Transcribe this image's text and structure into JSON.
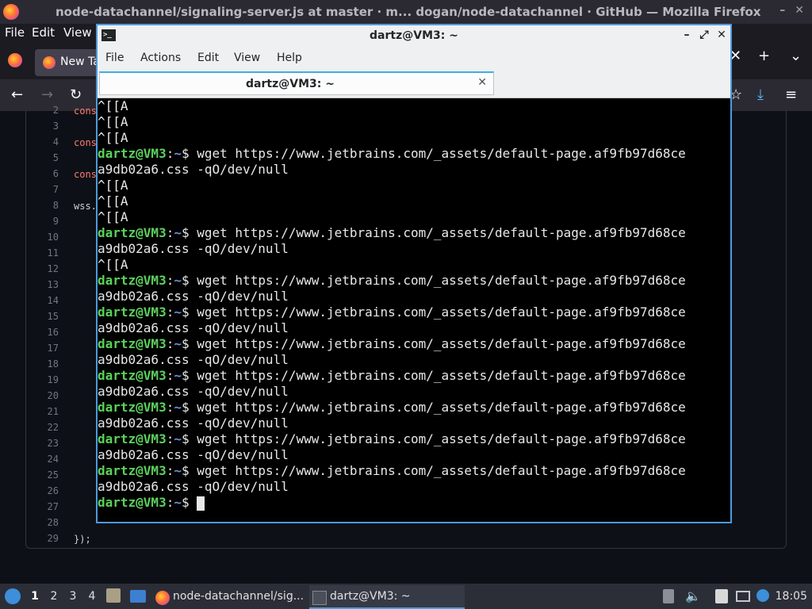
{
  "firefox": {
    "window_title": "node-datachannel/signaling-server.js at master · m...  dogan/node-datachannel · GitHub — Mozilla Firefox",
    "menu": [
      "File",
      "Edit",
      "View"
    ],
    "tab_label": "New Ta",
    "line_numbers": [
      "2",
      "3",
      "4",
      "5",
      "6",
      "7",
      "8",
      "9",
      "10",
      "11",
      "12",
      "13",
      "14",
      "15",
      "16",
      "17",
      "18",
      "19",
      "20",
      "21",
      "22",
      "23",
      "24",
      "25",
      "26",
      "27",
      "28",
      "29"
    ],
    "code_fragments": [
      "cons",
      "cons",
      "cons",
      "wss.",
      "});"
    ]
  },
  "terminal": {
    "window_title": "dartz@VM3: ~",
    "menu": [
      "File",
      "Actions",
      "Edit",
      "View",
      "Help"
    ],
    "tab_label": "dartz@VM3: ~",
    "prompt_user": "dartz@VM3",
    "prompt_sep": ":",
    "prompt_path": "~",
    "prompt_symbol": "$",
    "command": " wget https://www.jetbrains.com/_assets/default-page.af9fb97d68ce",
    "command_wrap": "a9db02a6.css -qO/dev/null",
    "arrow_echo": "^[[A"
  },
  "taskbar": {
    "workspaces": [
      "1",
      "2",
      "3",
      "4"
    ],
    "tasks": [
      {
        "label": "node-datachannel/sig...",
        "icon": "firefox-icon"
      },
      {
        "label": "dartz@VM3: ~",
        "icon": "terminal-icon"
      }
    ],
    "clock": "18:05"
  },
  "colors": {
    "accent": "#4e9bdc",
    "prompt_user": "#5ad15a",
    "prompt_path": "#6f8cd6"
  }
}
